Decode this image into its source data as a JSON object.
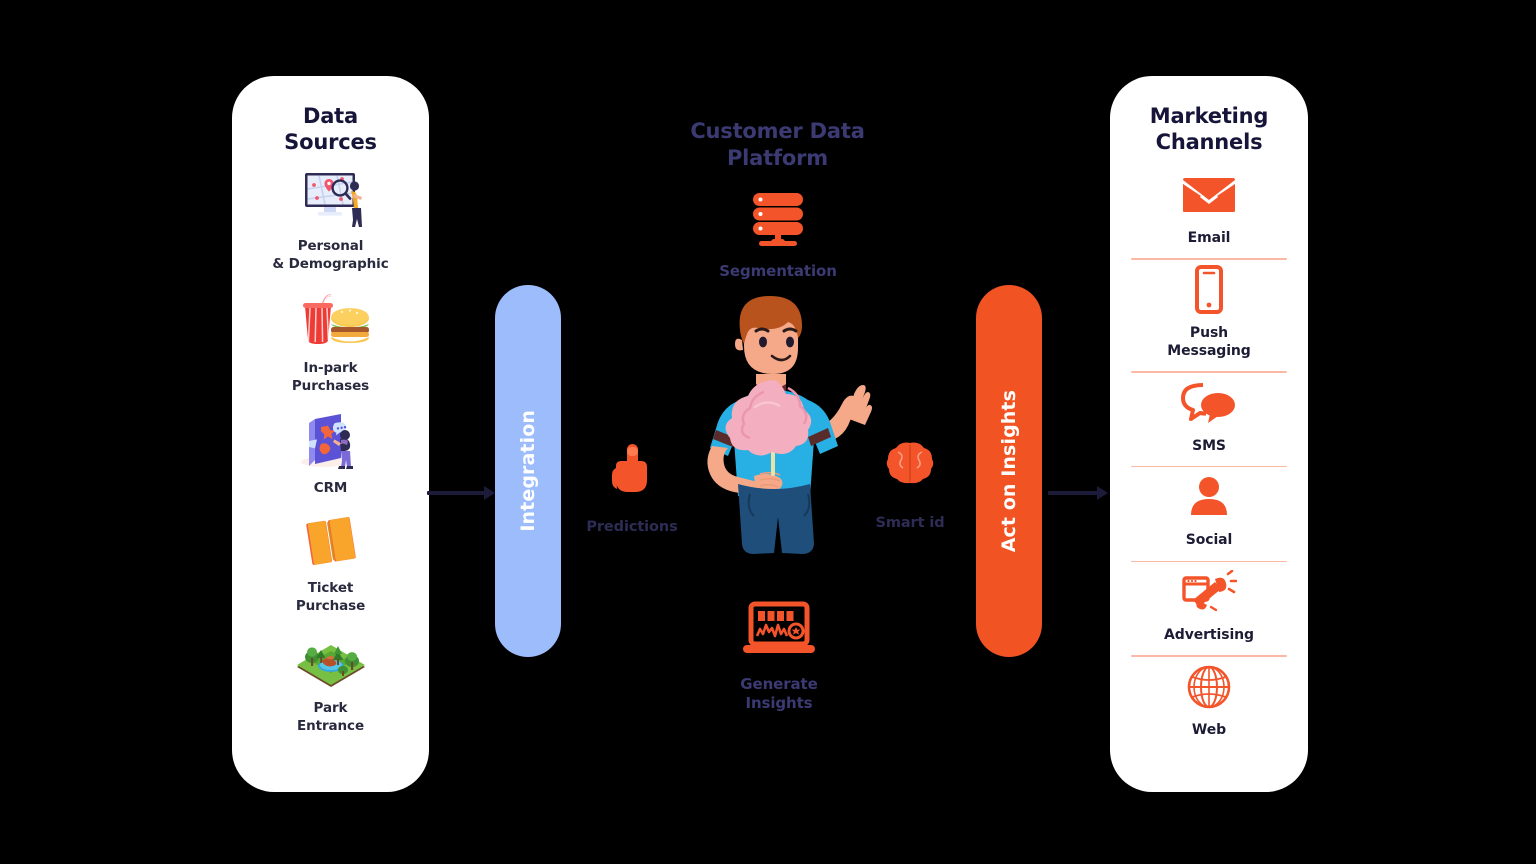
{
  "colors": {
    "background": "#000000",
    "panel_bg": "#ffffff",
    "accent_orange": "#f25322",
    "accent_blue": "#9dbcfb",
    "title_navy": "#161539",
    "title_purple": "#3b3a73",
    "divider_coral": "#fbb8a4",
    "arrow_navy": "#1d1b3a"
  },
  "left_panel": {
    "title": "Data\nSources",
    "title_line1": "Data",
    "title_line2": "Sources",
    "items": [
      {
        "icon": "monitor-map-search-icon",
        "label_line1": "Personal",
        "label_line2": "& Demographic",
        "label": "Personal & Demographic"
      },
      {
        "icon": "burger-drink-icon",
        "label_line1": "In-park",
        "label_line2": "Purchases",
        "label": "In-park Purchases"
      },
      {
        "icon": "mobile-crm-icon",
        "label_line1": "CRM",
        "label_line2": "",
        "label": "CRM"
      },
      {
        "icon": "tickets-icon",
        "label_line1": "Ticket",
        "label_line2": "Purchase",
        "label": "Ticket Purchase"
      },
      {
        "icon": "park-landscape-icon",
        "label_line1": "Park",
        "label_line2": "Entrance",
        "label": "Park Entrance"
      }
    ]
  },
  "integration_bar": {
    "label": "Integration"
  },
  "center": {
    "title_line1": "Customer Data",
    "title_line2": "Platform",
    "title": "Customer Data Platform",
    "segmentation": {
      "icon": "database-server-icon",
      "label": "Segmentation"
    },
    "predictions": {
      "icon": "pointing-hand-icon",
      "label": "Predictions"
    },
    "smart_id": {
      "icon": "brain-icon",
      "label": "Smart id"
    },
    "generate_insights": {
      "icon": "laptop-analytics-icon",
      "label_line1": "Generate",
      "label_line2": "Insights",
      "label": "Generate Insights"
    },
    "hero_illustration": "man-holding-cotton-candy-illustration"
  },
  "act_bar": {
    "label": "Act on Insights"
  },
  "right_panel": {
    "title_line1": "Marketing",
    "title_line2": "Channels",
    "title": "Marketing Channels",
    "items": [
      {
        "icon": "envelope-icon",
        "label_line1": "Email",
        "label_line2": "",
        "label": "Email"
      },
      {
        "icon": "smartphone-icon",
        "label_line1": "Push",
        "label_line2": "Messaging",
        "label": "Push Messaging"
      },
      {
        "icon": "speech-bubbles-icon",
        "label_line1": "SMS",
        "label_line2": "",
        "label": "SMS"
      },
      {
        "icon": "person-avatar-icon",
        "label_line1": "Social",
        "label_line2": "",
        "label": "Social"
      },
      {
        "icon": "megaphone-icon",
        "label_line1": "Advertising",
        "label_line2": "",
        "label": "Advertising"
      },
      {
        "icon": "globe-grid-icon",
        "label_line1": "Web",
        "label_line2": "",
        "label": "Web"
      }
    ]
  },
  "flow": {
    "left_arrow": "arrow-sources-to-integration",
    "right_arrow": "arrow-act-to-channels"
  }
}
